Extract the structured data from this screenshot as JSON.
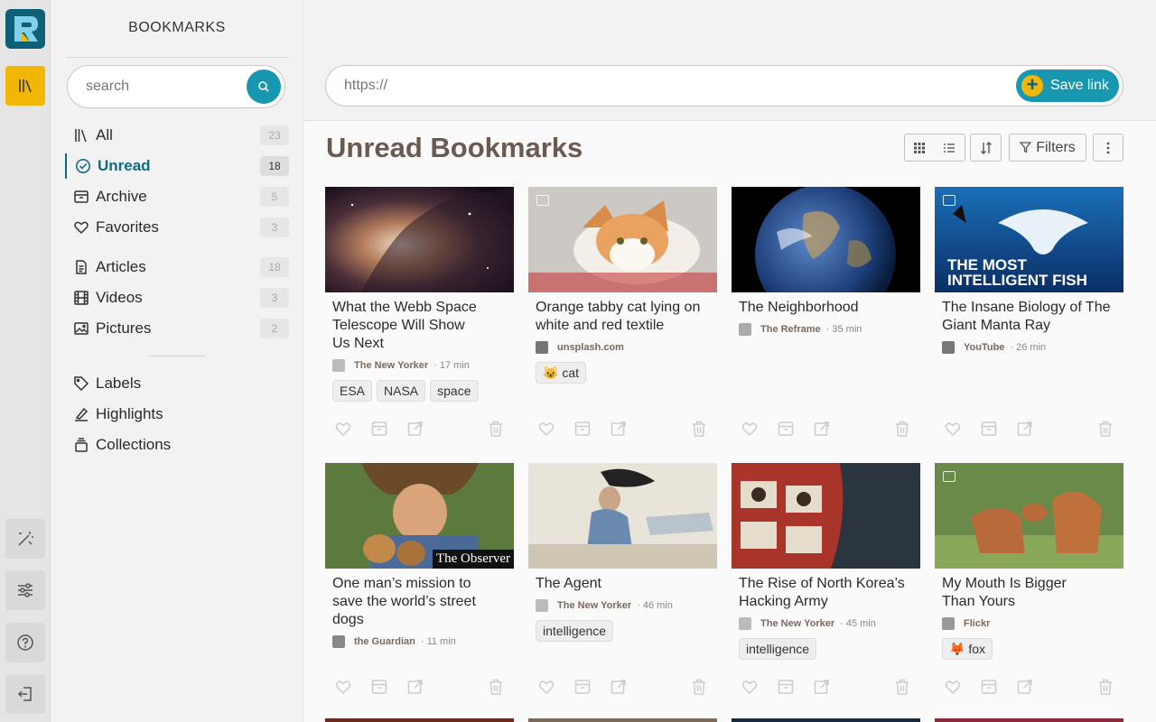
{
  "sidebar": {
    "title": "BOOKMARKS",
    "search_placeholder": "search",
    "nav": [
      {
        "label": "All",
        "count": "23",
        "icon": "library-icon"
      },
      {
        "label": "Unread",
        "count": "18",
        "icon": "check-circle-icon"
      },
      {
        "label": "Archive",
        "count": "5",
        "icon": "archive-icon"
      },
      {
        "label": "Favorites",
        "count": "3",
        "icon": "heart-icon"
      },
      {
        "label": "Articles",
        "count": "18",
        "icon": "document-icon"
      },
      {
        "label": "Videos",
        "count": "3",
        "icon": "film-icon"
      },
      {
        "label": "Pictures",
        "count": "2",
        "icon": "image-icon"
      }
    ],
    "secondary": [
      {
        "label": "Labels",
        "icon": "tag-icon"
      },
      {
        "label": "Highlights",
        "icon": "highlighter-icon"
      },
      {
        "label": "Collections",
        "icon": "collections-icon"
      }
    ]
  },
  "topbar": {
    "url_placeholder": "https://",
    "save_label": "Save link"
  },
  "main": {
    "title": "Unread Bookmarks",
    "filters_label": "Filters"
  },
  "colors": {
    "accent": "#1797b0",
    "brand_yellow": "#f2b705",
    "active_nav": "#0f6b85",
    "title_brown": "#6b5a4f"
  },
  "cards": [
    {
      "title": "What the Webb Space Telescope Will Show Us Next",
      "source": "The New Yorker",
      "time": "· 17 min",
      "tags": [
        "ESA",
        "NASA",
        "space"
      ]
    },
    {
      "title": "Orange tabby cat lying on white and red textile",
      "source": "unsplash.com",
      "time": "",
      "tags": [
        "😺 cat"
      ]
    },
    {
      "title": "The Neighborhood",
      "source": "The Reframe",
      "time": "· 35 min",
      "tags": []
    },
    {
      "title": "The Insane Biology of The Giant Manta Ray",
      "source": "YouTube",
      "time": "· 26 min",
      "tags": [],
      "thumb_text": "THE MOST INTELLIGENT FISH"
    },
    {
      "title": "One man’s mission to save the world’s street dogs",
      "source": "the Guardian",
      "time": "· 11 min",
      "tags": [],
      "thumb_text": "The Observer"
    },
    {
      "title": "The Agent",
      "source": "The New Yorker",
      "time": "· 46 min",
      "tags": [
        "intelligence"
      ]
    },
    {
      "title": "The Rise of North Korea’s Hacking Army",
      "source": "The New Yorker",
      "time": "· 45 min",
      "tags": [
        "intelligence"
      ]
    },
    {
      "title": "My Mouth Is Bigger Than Yours",
      "source": "Flickr",
      "time": "",
      "tags": [
        "🦊 fox"
      ]
    }
  ]
}
